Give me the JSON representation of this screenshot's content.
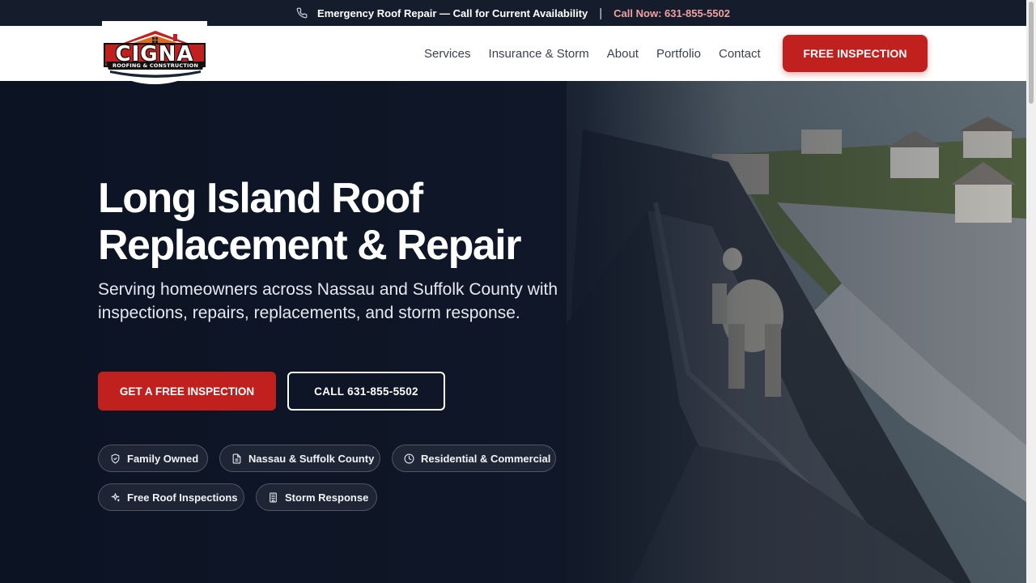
{
  "topbar": {
    "emergency_text": "Emergency Roof Repair — Call for Current Availability",
    "separator": "|",
    "call_text": "Call Now: 631-855-5502"
  },
  "header": {
    "logo": {
      "brand": "CIGNA",
      "tagline": "ROOFING & CONSTRUCTION"
    },
    "nav": [
      {
        "label": "Services"
      },
      {
        "label": "Insurance & Storm"
      },
      {
        "label": "About"
      },
      {
        "label": "Portfolio"
      },
      {
        "label": "Contact"
      }
    ],
    "cta_label": "FREE INSPECTION"
  },
  "hero": {
    "title_line1": "Long Island Roof",
    "title_line2": "Replacement & Repair",
    "subtitle": "Serving homeowners across Nassau and Suffolk County with inspections, repairs, replacements, and storm response.",
    "primary_cta": "GET A FREE INSPECTION",
    "secondary_cta": "CALL 631-855-5502",
    "badges": [
      {
        "label": "Family Owned",
        "icon": "shield-icon"
      },
      {
        "label": "Nassau & Suffolk County",
        "icon": "document-icon"
      },
      {
        "label": "Residential & Commercial",
        "icon": "clock-icon"
      },
      {
        "label": "Free Roof Inspections",
        "icon": "sparkle-icon"
      },
      {
        "label": "Storm Response",
        "icon": "building-icon"
      }
    ]
  },
  "colors": {
    "brand_red": "#c0211f",
    "topbar_bg": "#151d2c",
    "hero_bg": "#0e1627",
    "call_text": "#f0a0a0"
  }
}
